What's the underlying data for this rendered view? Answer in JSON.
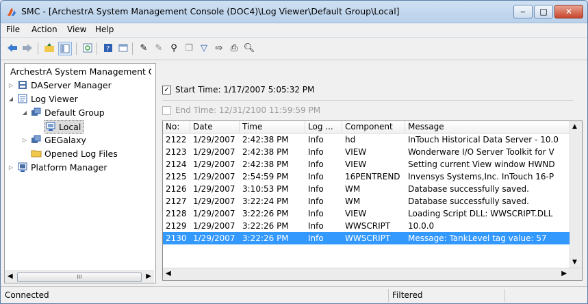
{
  "window": {
    "title": "SMC - [ArchestrA System Management Console (DOC4)\\Log Viewer\\Default Group\\Local]",
    "controls": {
      "minimize": "‒",
      "maximize": "□",
      "close": "✕"
    }
  },
  "menu": {
    "items": [
      "File",
      "Action",
      "View",
      "Help"
    ]
  },
  "toolbar": {
    "icons": [
      "back-arrow-icon",
      "forward-arrow-icon",
      "up-folder-icon",
      "show-hide-tree-icon",
      "refresh-icon",
      "help-icon",
      "properties-icon",
      "message-filter-icon",
      "marker-icon",
      "find-icon",
      "copy-icon",
      "filter-icon",
      "export-icon",
      "print-icon",
      "print-preview-icon"
    ]
  },
  "tree": {
    "nodes": [
      {
        "label": "ArchestrA System Management Console",
        "icon": "archestra-icon"
      },
      {
        "label": "DAServer Manager",
        "icon": "server-icon"
      },
      {
        "label": "Log Viewer",
        "icon": "log-viewer-icon"
      },
      {
        "label": "Default Group",
        "icon": "group-icon"
      },
      {
        "label": "Local",
        "icon": "computer-icon"
      },
      {
        "label": "GEGalaxy",
        "icon": "group-icon"
      },
      {
        "label": "Opened Log Files",
        "icon": "folder-icon"
      },
      {
        "label": "Platform Manager",
        "icon": "platform-icon"
      }
    ],
    "scroll_thumb": "III"
  },
  "filter": {
    "start": {
      "checked": true,
      "label": "Start Time: 1/17/2007   5:05:32 PM"
    },
    "end": {
      "checked": false,
      "label": "End Time: 12/31/2100   11:59:59 PM"
    }
  },
  "log": {
    "columns": [
      "No:",
      "Date",
      "Time",
      "Log ...",
      "Component",
      "Message"
    ],
    "rows": [
      [
        "2122",
        "1/29/2007",
        "2:42:38 PM",
        "Info",
        "hd",
        "InTouch Historical Data Server - 10.0"
      ],
      [
        "2123",
        "1/29/2007",
        "2:42:38 PM",
        "Info",
        "VIEW",
        "Wonderware I/O Server Toolkit for V"
      ],
      [
        "2124",
        "1/29/2007",
        "2:42:38 PM",
        "Info",
        "VIEW",
        "Setting current View window HWND"
      ],
      [
        "2125",
        "1/29/2007",
        "2:54:59 PM",
        "Info",
        "16PENTREND",
        "Invensys Systems,Inc. InTouch 16-P"
      ],
      [
        "2126",
        "1/29/2007",
        "3:10:53 PM",
        "Info",
        "WM",
        "Database successfully saved."
      ],
      [
        "2127",
        "1/29/2007",
        "3:22:24 PM",
        "Info",
        "WM",
        "Database successfully saved."
      ],
      [
        "2128",
        "1/29/2007",
        "3:22:26 PM",
        "Info",
        "VIEW",
        "Loading Script DLL: WWSCRIPT.DLL"
      ],
      [
        "2129",
        "1/29/2007",
        "3:22:26 PM",
        "Info",
        "WWSCRIPT",
        "10.0.0"
      ],
      [
        "2130",
        "1/29/2007",
        "3:22:26 PM",
        "Info",
        "WWSCRIPT",
        "Message: TankLevel tag value: 57"
      ]
    ],
    "selected_row": "2130"
  },
  "status": {
    "left": "Connected",
    "right": "Filtered"
  },
  "colors": {
    "selection": "#3399ff",
    "title_gradient": "#cfe0f3"
  }
}
